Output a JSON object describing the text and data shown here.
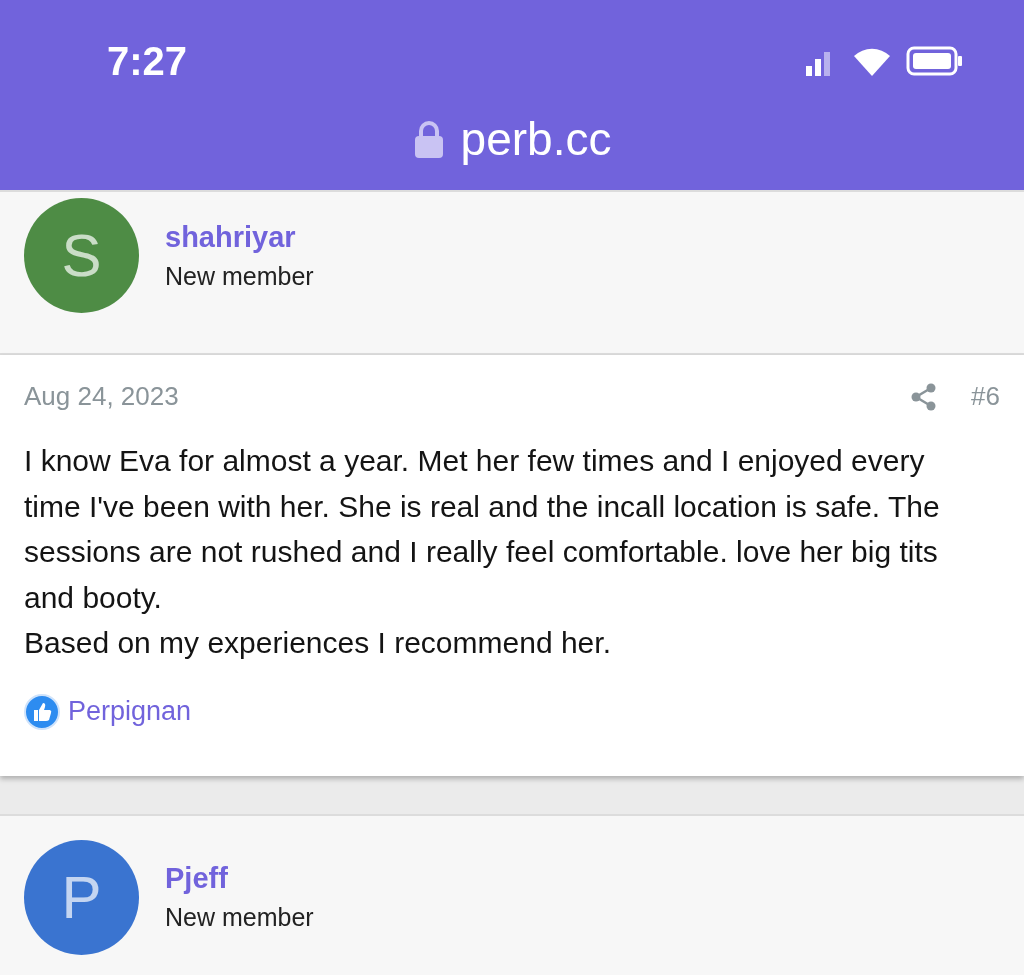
{
  "status_bar": {
    "time": "7:27"
  },
  "address_bar": {
    "url": "perb.cc"
  },
  "posts": [
    {
      "kind": "author",
      "avatar_letter": "S",
      "color": "#4e8c45",
      "name": "shahriyar",
      "role": "New member"
    },
    {
      "kind": "message",
      "date": "Aug 24, 2023",
      "number": "#6",
      "paragraphs": [
        "I know Eva for almost a year. Met her few times and I enjoyed every time I've been with her. She is real and the incall location is safe. The sessions are not rushed and I really feel comfortable. love her big tits and booty.",
        "Based on my experiences I recommend her."
      ],
      "reaction": "Perpignan"
    },
    {
      "kind": "author",
      "avatar_letter": "P",
      "color": "#3a74d0",
      "name": "Pjeff",
      "role": "New member"
    }
  ]
}
